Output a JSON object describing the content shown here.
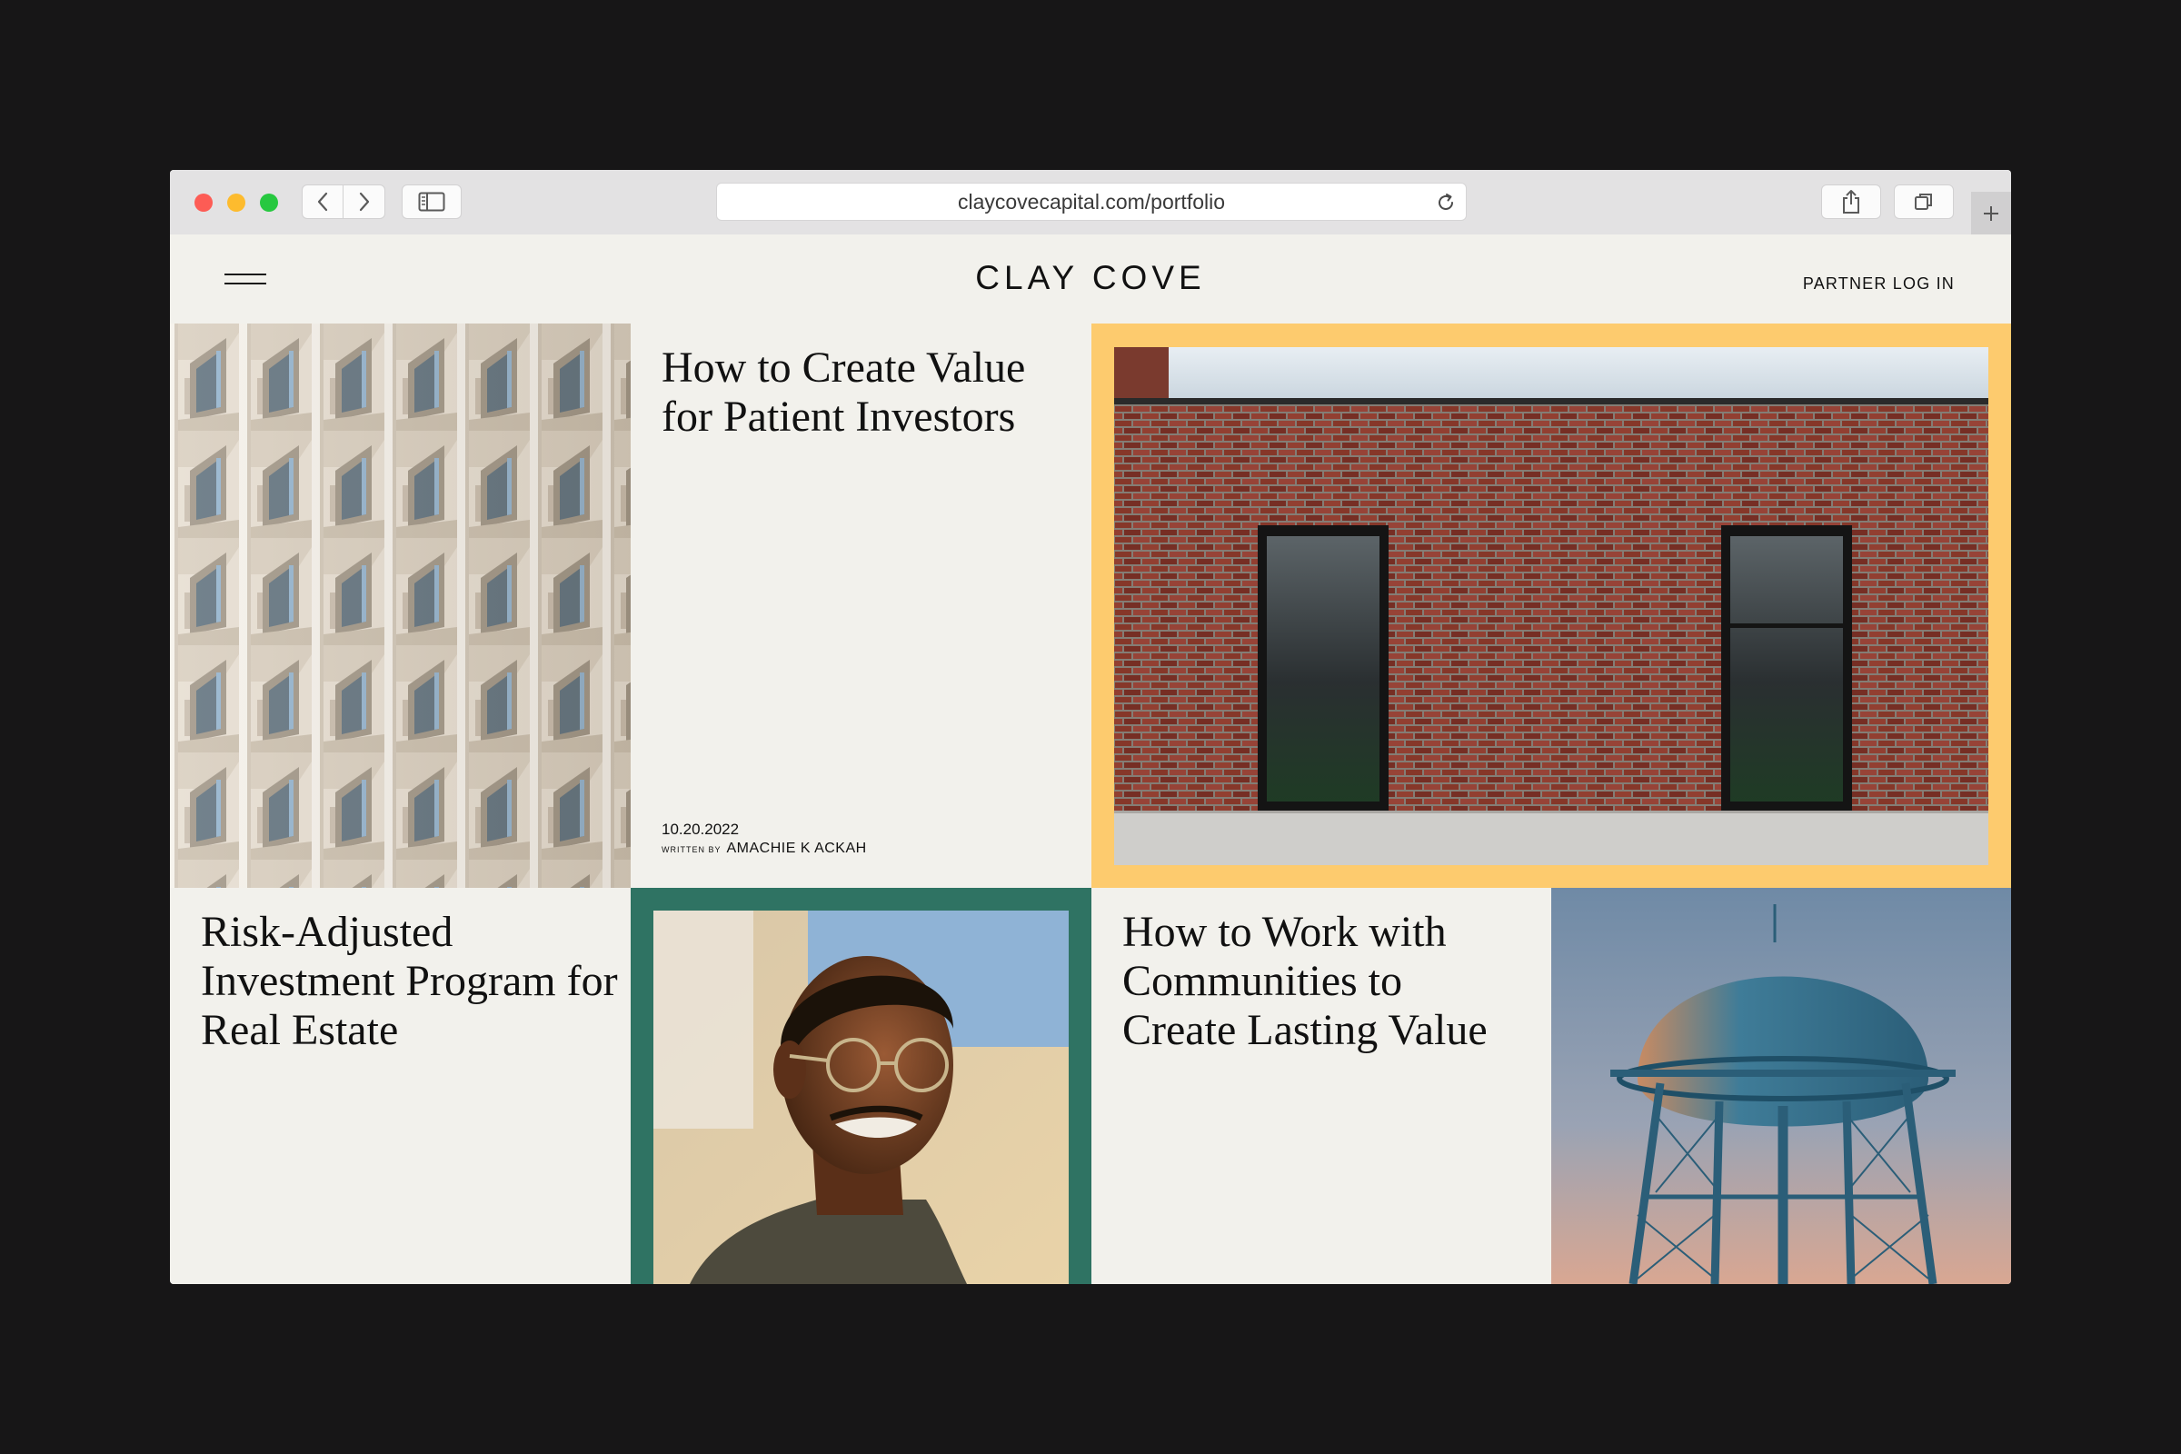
{
  "browser": {
    "url": "claycovecapital.com/portfolio"
  },
  "site": {
    "logo": "CLAY COVE",
    "partner_login": "PARTNER LOG IN"
  },
  "articles": [
    {
      "title": "How to Create Value for Patient Investors",
      "date": "10.20.2022",
      "written_by_label": "WRITTEN BY",
      "author": "AMACHIE K ACKAH"
    },
    {
      "title": "Risk-Adjusted Investment Program for Real Estate"
    },
    {
      "title": "How to Work with Communities to Create Lasting Value"
    }
  ],
  "colors": {
    "page_bg": "#f2f1ec",
    "accent_yellow": "#fdcb6e",
    "accent_green": "#2f7363",
    "backdrop": "#171617"
  },
  "icons": {
    "menu": "hamburger-icon",
    "back": "chevron-left-icon",
    "forward": "chevron-right-icon",
    "sidebar": "sidebar-icon",
    "reload": "reload-icon",
    "share": "share-icon",
    "tabs": "tabs-icon",
    "new_tab": "plus-icon"
  }
}
